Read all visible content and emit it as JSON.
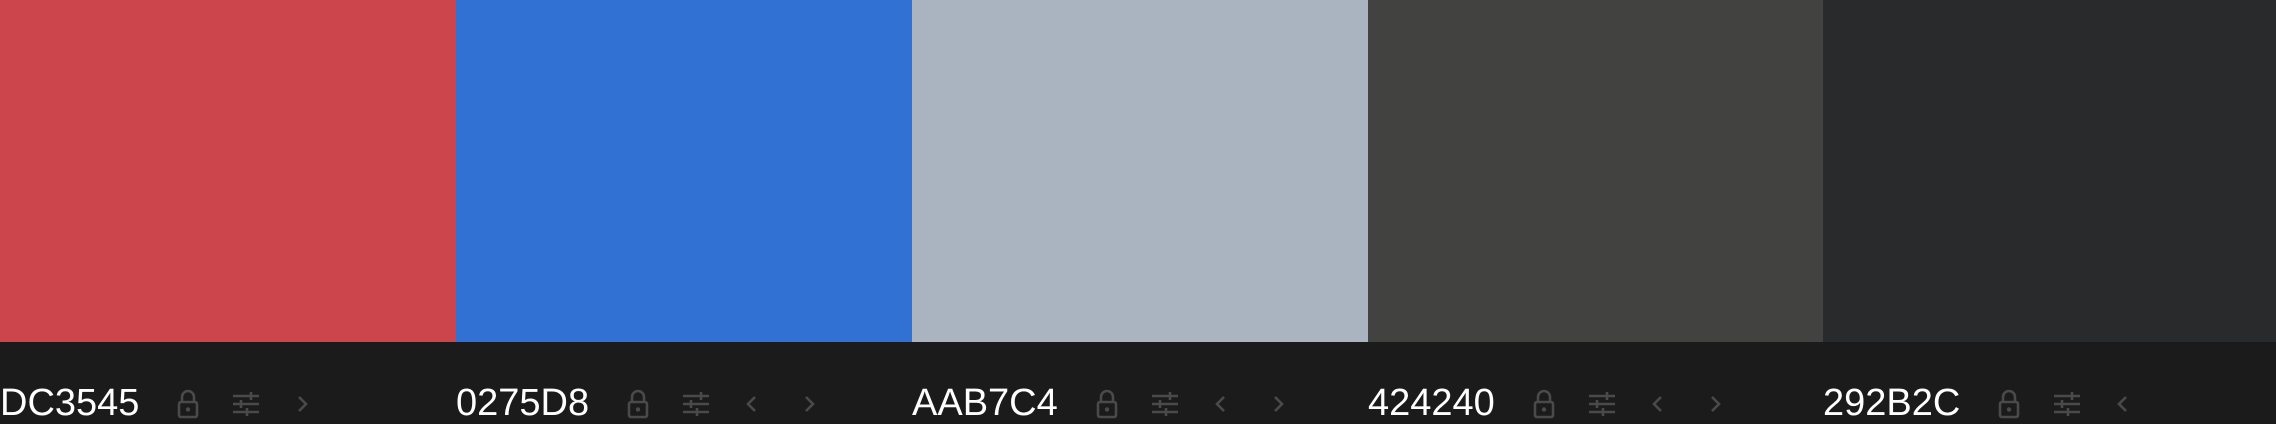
{
  "palette": {
    "colors": [
      {
        "hex_label": "DC3545",
        "swatch_color": "#CD454C",
        "actions": [
          "lock",
          "adjust",
          "right"
        ]
      },
      {
        "hex_label": "0275D8",
        "swatch_color": "#3171D3",
        "actions": [
          "lock",
          "adjust",
          "left",
          "right"
        ]
      },
      {
        "hex_label": "AAB7C4",
        "swatch_color": "#AAB4C1",
        "actions": [
          "lock",
          "adjust",
          "left",
          "right"
        ]
      },
      {
        "hex_label": "424240",
        "swatch_color": "#424240",
        "actions": [
          "lock",
          "adjust",
          "left",
          "right"
        ]
      },
      {
        "hex_label": "292B2C",
        "swatch_color": "#292A2C",
        "actions": [
          "lock",
          "adjust",
          "left"
        ]
      }
    ],
    "icon_color": "#4a4a4a",
    "background": "#1b1b1b",
    "icons": {
      "lock": "lock-icon",
      "adjust": "sliders-icon",
      "left": "chevron-left-icon",
      "right": "chevron-right-icon"
    }
  }
}
